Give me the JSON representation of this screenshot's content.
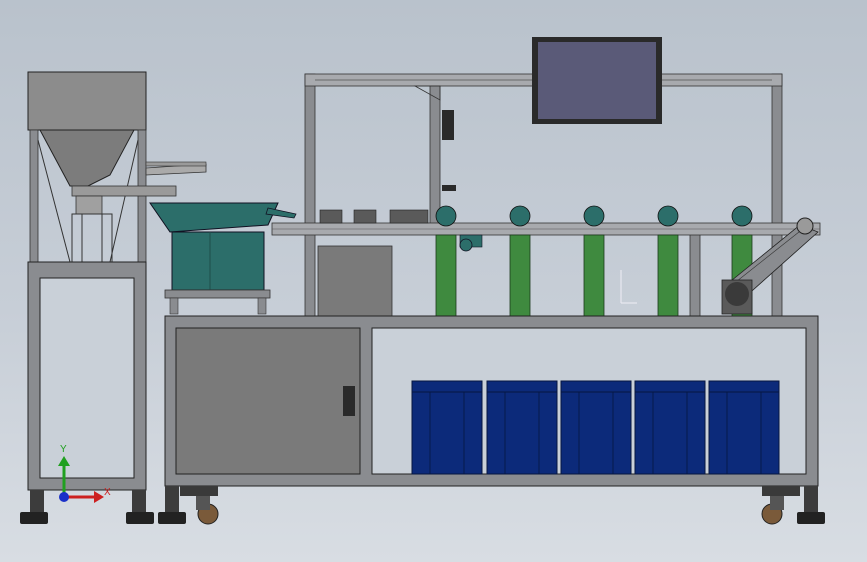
{
  "triad": {
    "x_label": "X",
    "y_label": "Y",
    "x_color": "#cc2020",
    "y_color": "#20a020",
    "origin_color": "#1a30c8"
  },
  "colors": {
    "frame": "#8a8c90",
    "frame_dark": "#4a4c50",
    "hopper": "#8c8c8c",
    "bowl": "#2c6e6a",
    "tubes": "#3f8a3f",
    "bins": "#0c2a7a",
    "monitor": "#5a5a78",
    "cabinet": "#7a7a7a"
  },
  "icons": {
    "triad": "coordinate-triad-icon",
    "caster": "caster-wheel-icon",
    "monitor": "monitor-icon"
  }
}
